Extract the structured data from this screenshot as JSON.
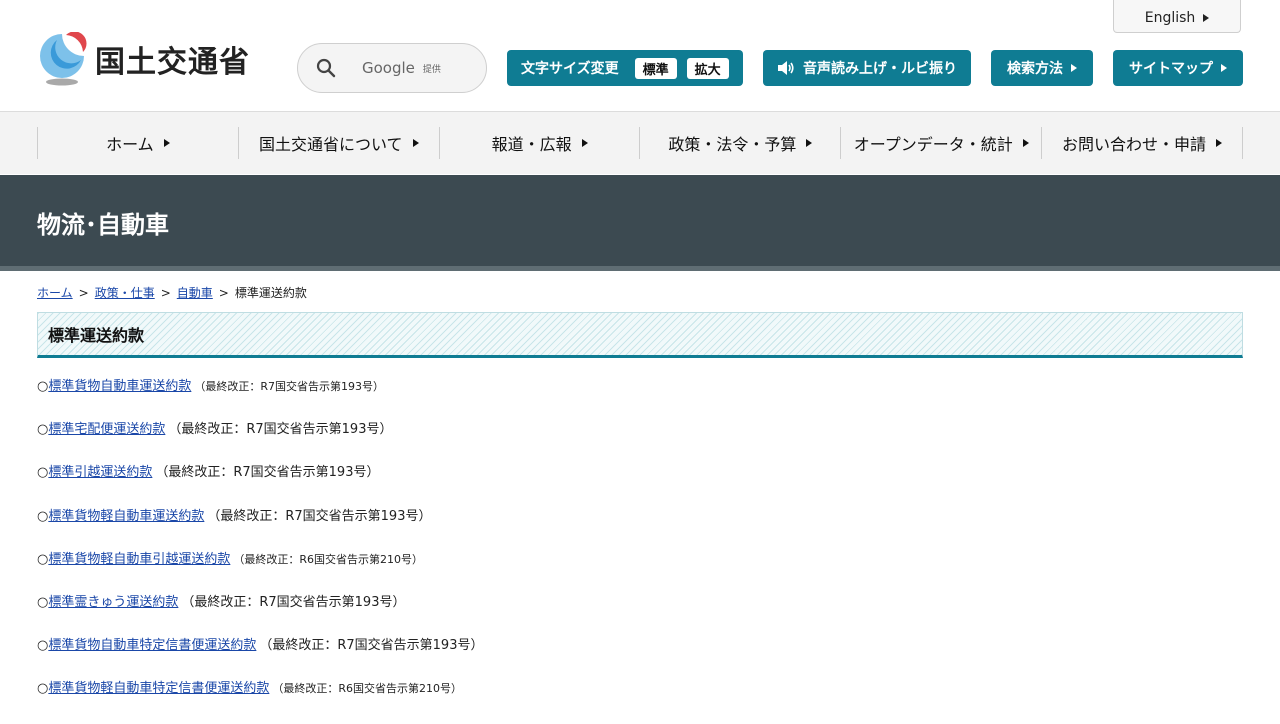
{
  "header": {
    "english_label": "English",
    "site_name": "国土交通省",
    "search": {
      "provider": "Google",
      "provided": "提供"
    },
    "font_size": {
      "label": "文字サイズ変更",
      "options": [
        "標準",
        "拡大"
      ]
    },
    "speech_label": "音声読み上げ・ルビ振り",
    "search_method_label": "検索方法",
    "sitemap_label": "サイトマップ"
  },
  "nav": {
    "items": [
      {
        "label": "ホーム"
      },
      {
        "label": "国土交通省について"
      },
      {
        "label": "報道・広報"
      },
      {
        "label": "政策・法令・予算"
      },
      {
        "label": "オープンデータ・統計"
      },
      {
        "label": "お問い合わせ・申請"
      }
    ]
  },
  "banner": {
    "title": "物流･自動車"
  },
  "breadcrumb": {
    "items": [
      "ホーム",
      "政策・仕事",
      "自動車"
    ],
    "separator": ">",
    "current": "標準運送約款"
  },
  "page": {
    "title": "標準運送約款",
    "bullet": "○",
    "items": [
      {
        "link": "標準貨物自動車運送約款",
        "note": "（最終改正：R7国交省告示第193号）"
      },
      {
        "link": "標準宅配便運送約款",
        "note": "（最終改正：R7国交省告示第193号）"
      },
      {
        "link": "標準引越運送約款",
        "note": "（最終改正：R7国交省告示第193号）"
      },
      {
        "link": "標準貨物軽自動車運送約款",
        "note": "（最終改正：R7国交省告示第193号）"
      },
      {
        "link": "標準貨物軽自動車引越運送約款",
        "note": "（最終改正：R6国交省告示第210号）"
      },
      {
        "link": "標準霊きゅう運送約款",
        "note": "（最終改正：R7国交省告示第193号）"
      },
      {
        "link": "標準貨物自動車特定信書便運送約款",
        "note": "（最終改正：R7国交省告示第193号）"
      },
      {
        "link": "標準貨物軽自動車特定信書便運送約款",
        "note": "（最終改正：R6国交省告示第210号）"
      }
    ]
  },
  "colors": {
    "accent": "#0f7c93",
    "banner": "#3c4a51",
    "link": "#1a47a8",
    "logo_red": "#e0474c",
    "logo_blue": "#2a8fd0"
  }
}
